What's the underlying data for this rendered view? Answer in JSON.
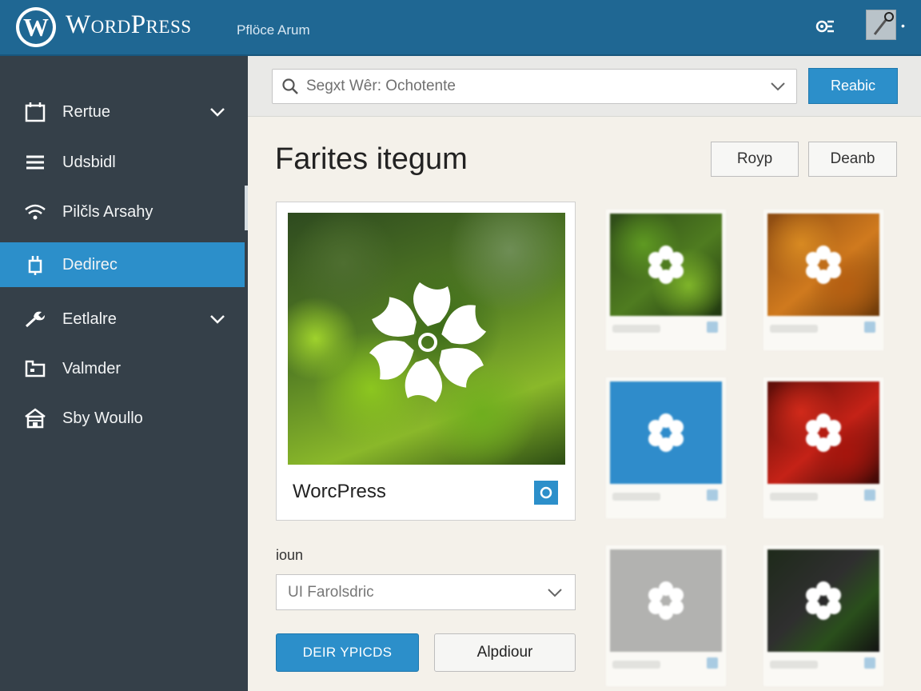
{
  "header": {
    "brand": "WordPress",
    "subtitle": "Pflöce Arum"
  },
  "sidebar": {
    "items": [
      {
        "label": "Rertue",
        "icon": "calendar-icon",
        "has_chevron": true
      },
      {
        "label": "Udsbidl",
        "icon": "menu-lines-icon",
        "has_chevron": false
      },
      {
        "label": "Pilčls Arsahy",
        "icon": "wifi-icon",
        "has_chevron": false
      },
      {
        "label": "Dedirec",
        "icon": "plugin-icon",
        "has_chevron": false,
        "active": true
      },
      {
        "label": "Eetlalre",
        "icon": "wrench-icon",
        "has_chevron": true
      },
      {
        "label": "Valmder",
        "icon": "folder-icon",
        "has_chevron": false
      },
      {
        "label": "Sby Woullo",
        "icon": "store-icon",
        "has_chevron": false
      }
    ]
  },
  "search": {
    "value": "Segxt Wêr: Ochotente",
    "button_label": "Reabic"
  },
  "main": {
    "title": "Farites itegum",
    "btn_roy": "Royp",
    "btn_deanb": "Deanb",
    "feature_caption": "WorcPress",
    "field_label": "ioun",
    "select_value": "UI Farolsdric",
    "primary_button": "DEIR YPICDS",
    "secondary_button": "Alpdiour"
  },
  "colors": {
    "topbar": "#1f6793",
    "sidebar": "#354049",
    "accent": "#2c8fca",
    "background": "#f4f1ea"
  },
  "thumbnails": [
    {
      "color": "green-foliage"
    },
    {
      "color": "orange-leaves"
    },
    {
      "color": "solid-blue"
    },
    {
      "color": "red-leaves"
    },
    {
      "color": "gray"
    },
    {
      "color": "dark-green"
    }
  ]
}
